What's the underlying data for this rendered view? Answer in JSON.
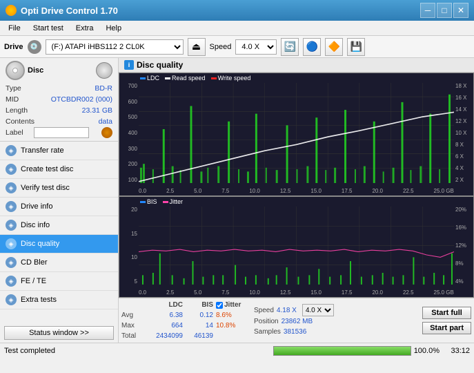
{
  "titleBar": {
    "title": "Opti Drive Control 1.70",
    "icon": "cd-icon"
  },
  "menuBar": {
    "items": [
      "File",
      "Start test",
      "Extra",
      "Help"
    ]
  },
  "driveBar": {
    "label": "Drive",
    "driveValue": "(F:) ATAPI iHBS112  2 CL0K",
    "speedLabel": "Speed",
    "speedValue": "4.0 X"
  },
  "sidebar": {
    "discSection": {
      "label": "Disc",
      "type_label": "Type",
      "type_value": "BD-R",
      "mid_label": "MID",
      "mid_value": "OTCBDR002 (000)",
      "length_label": "Length",
      "length_value": "23.31 GB",
      "contents_label": "Contents",
      "contents_value": "data",
      "label_label": "Label",
      "label_value": ""
    },
    "navItems": [
      {
        "id": "transfer-rate",
        "label": "Transfer rate"
      },
      {
        "id": "create-test-disc",
        "label": "Create test disc"
      },
      {
        "id": "verify-test-disc",
        "label": "Verify test disc"
      },
      {
        "id": "drive-info",
        "label": "Drive info"
      },
      {
        "id": "disc-info",
        "label": "Disc info"
      },
      {
        "id": "disc-quality",
        "label": "Disc quality",
        "active": true
      },
      {
        "id": "cd-bler",
        "label": "CD Bler"
      },
      {
        "id": "fe-te",
        "label": "FE / TE"
      },
      {
        "id": "extra-tests",
        "label": "Extra tests"
      }
    ],
    "statusBtn": "Status window >>"
  },
  "discQuality": {
    "title": "Disc quality",
    "legends": [
      {
        "label": "LDC",
        "color": "#2288ff"
      },
      {
        "label": "Read speed",
        "color": "#ffffff"
      },
      {
        "label": "Write speed",
        "color": "#ee2222"
      }
    ],
    "legends2": [
      {
        "label": "BIS",
        "color": "#2288ff"
      },
      {
        "label": "Jitter",
        "color": "#ff44aa"
      }
    ],
    "topChart": {
      "yAxisLeft": [
        "700",
        "600",
        "500",
        "400",
        "300",
        "200",
        "100"
      ],
      "yAxisRight": [
        "18 X",
        "16 X",
        "14 X",
        "12 X",
        "10 X",
        "8 X",
        "6 X",
        "4 X",
        "2 X"
      ],
      "xAxis": [
        "0.0",
        "2.5",
        "5.0",
        "7.5",
        "10.0",
        "12.5",
        "15.0",
        "17.5",
        "20.0",
        "22.5",
        "25.0 GB"
      ]
    },
    "bottomChart": {
      "yAxisLeft": [
        "20",
        "15",
        "10",
        "5"
      ],
      "yAxisRight": [
        "20%",
        "16%",
        "12%",
        "8%",
        "4%"
      ],
      "xAxis": [
        "0.0",
        "2.5",
        "5.0",
        "7.5",
        "10.0",
        "12.5",
        "15.0",
        "17.5",
        "20.0",
        "22.5",
        "25.0 GB"
      ]
    },
    "stats": {
      "jitterChecked": true,
      "jitterLabel": "Jitter",
      "speedLabel": "Speed",
      "speedValue": "4.18 X",
      "speedSelect": "4.0 X",
      "positionLabel": "Position",
      "positionValue": "23862 MB",
      "samplesLabel": "Samples",
      "samplesValue": "381536",
      "ldcLabel": "LDC",
      "bisLabel": "BIS",
      "rows": [
        {
          "label": "Avg",
          "ldc": "6.38",
          "bis": "0.12",
          "jitter": "8.6%"
        },
        {
          "label": "Max",
          "ldc": "664",
          "bis": "14",
          "jitter": "10.8%"
        },
        {
          "label": "Total",
          "ldc": "2434099",
          "bis": "46139",
          "jitter": ""
        }
      ],
      "startFull": "Start full",
      "startPart": "Start part"
    }
  },
  "statusBar": {
    "text": "Test completed",
    "progress": "100.0%",
    "time": "33:12"
  }
}
